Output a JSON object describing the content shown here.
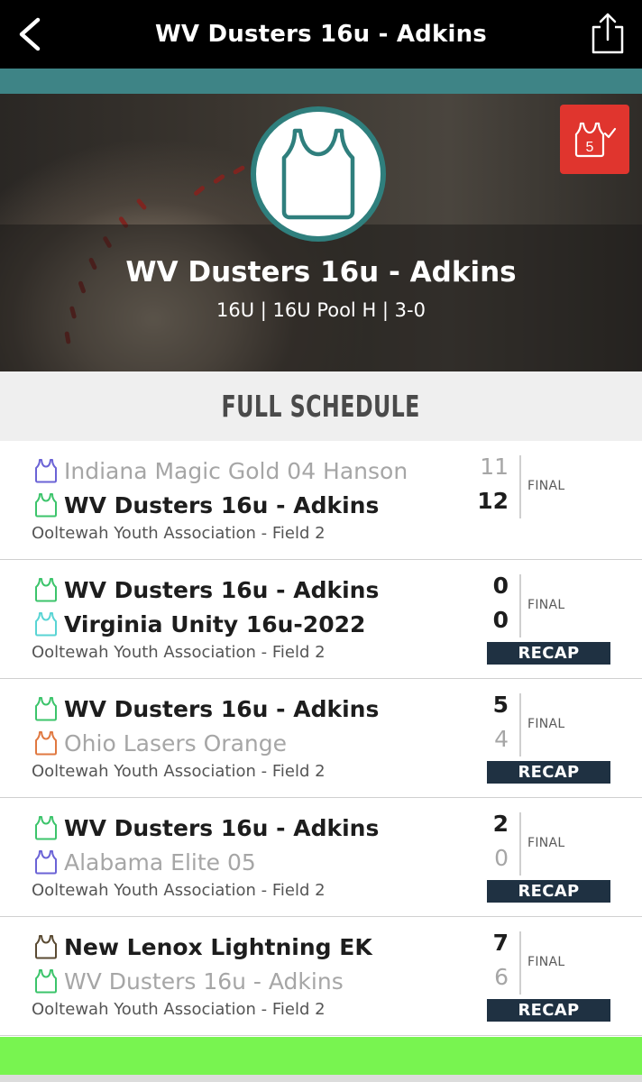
{
  "nav": {
    "title": "WV Dusters 16u - Adkins"
  },
  "hero": {
    "team_name": "WV Dusters 16u - Adkins",
    "subtitle": "16U | 16U Pool H | 3-0",
    "badge_number": "5",
    "logo_color": "#2f7f7d"
  },
  "section": {
    "title": "FULL SCHEDULE"
  },
  "games": [
    {
      "home": {
        "name": "Indiana Magic Gold 04 Hanson",
        "score": "11",
        "icon_color": "#6b63d6",
        "winner": false
      },
      "away": {
        "name": "WV Dusters 16u - Adkins",
        "score": "12",
        "icon_color": "#3cc46b",
        "winner": true
      },
      "venue": "Ooltewah Youth Association - Field 2",
      "status": "FINAL",
      "recap": null
    },
    {
      "home": {
        "name": "WV Dusters 16u - Adkins",
        "score": "0",
        "icon_color": "#3cc46b",
        "winner": true
      },
      "away": {
        "name": "Virginia Unity 16u-2022",
        "score": "0",
        "icon_color": "#59d4d4",
        "winner": true
      },
      "venue": "Ooltewah Youth Association - Field 2",
      "status": "FINAL",
      "recap": "RECAP"
    },
    {
      "home": {
        "name": "WV Dusters 16u - Adkins",
        "score": "5",
        "icon_color": "#3cc46b",
        "winner": true
      },
      "away": {
        "name": "Ohio Lasers Orange",
        "score": "4",
        "icon_color": "#e07840",
        "winner": false
      },
      "venue": "Ooltewah Youth Association - Field 2",
      "status": "FINAL",
      "recap": "RECAP"
    },
    {
      "home": {
        "name": "WV Dusters 16u - Adkins",
        "score": "2",
        "icon_color": "#3cc46b",
        "winner": true
      },
      "away": {
        "name": "Alabama Elite 05",
        "score": "0",
        "icon_color": "#6b63d6",
        "winner": false
      },
      "venue": "Ooltewah Youth Association - Field 2",
      "status": "FINAL",
      "recap": "RECAP"
    },
    {
      "home": {
        "name": "New Lenox Lightning EK",
        "score": "7",
        "icon_color": "#5a4a32",
        "winner": true
      },
      "away": {
        "name": "WV Dusters 16u - Adkins",
        "score": "6",
        "icon_color": "#3cc46b",
        "winner": false
      },
      "venue": "Ooltewah Youth Association - Field 2",
      "status": "FINAL",
      "recap": "RECAP"
    }
  ],
  "icons": {
    "back": "chevron-left-icon",
    "share": "share-icon",
    "jersey": "jersey-icon",
    "favorite_badge": "jersey-check-icon"
  },
  "colors": {
    "nav_bg": "#000000",
    "teal_strip": "#3e8486",
    "recap_bg": "#1f3142",
    "badge_red": "#e0352e",
    "bottom_bar": "#78f450"
  }
}
